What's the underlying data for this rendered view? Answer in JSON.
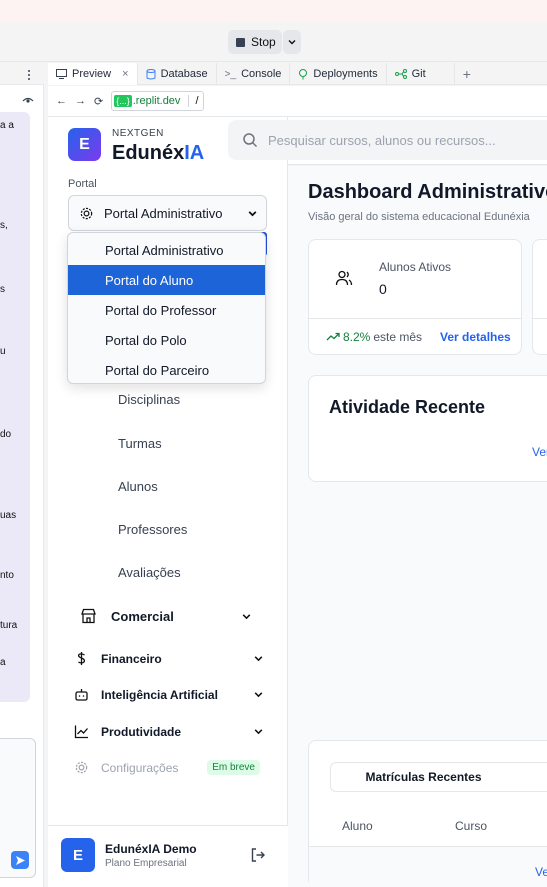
{
  "topbar": {
    "stop_label": "Stop"
  },
  "left_panel": {
    "fragments": [
      "a a",
      "s,",
      "s",
      "u",
      "do",
      "uas",
      "nto",
      "tura",
      "a"
    ]
  },
  "tabs": [
    {
      "label": "Preview",
      "icon": "monitor-icon",
      "active": true
    },
    {
      "label": "Database",
      "icon": "database-icon"
    },
    {
      "label": "Console",
      "icon": "terminal-icon"
    },
    {
      "label": "Deployments",
      "icon": "deployments-icon"
    },
    {
      "label": "Git",
      "icon": "git-icon"
    }
  ],
  "urlbar": {
    "domain_badge": "{...}",
    "domain": ".replit.dev",
    "path": "/"
  },
  "app": {
    "brand_small": "NEXTGEN",
    "brand_main": "Edunéx",
    "brand_accent": "IA",
    "logo_letter": "E"
  },
  "search": {
    "placeholder": "Pesquisar cursos, alunos ou recursos..."
  },
  "portal": {
    "label": "Portal",
    "selected": "Portal Administrativo",
    "options": [
      "Portal Administrativo",
      "Portal do Aluno",
      "Portal do Professor",
      "Portal do Polo",
      "Portal do Parceiro"
    ],
    "highlighted_index": 1
  },
  "nav": {
    "subitems": [
      "Disciplinas",
      "Turmas",
      "Alunos",
      "Professores",
      "Avaliações"
    ],
    "groups": [
      {
        "label": "Comercial",
        "icon": "store-icon"
      },
      {
        "label": "Financeiro",
        "icon": "dollar-icon"
      },
      {
        "label": "Inteligência Artificial",
        "icon": "bot-icon"
      },
      {
        "label": "Produtividade",
        "icon": "chart-line-icon"
      }
    ],
    "settings": {
      "label": "Configurações",
      "badge": "Em breve",
      "icon": "gear-icon"
    }
  },
  "user": {
    "avatar": "E",
    "name": "EdunéxIA Demo",
    "plan": "Plano Empresarial"
  },
  "dashboard": {
    "title": "Dashboard Administrativo",
    "subtitle": "Visão geral do sistema educacional Edunéxia",
    "stat": {
      "title": "Alunos Ativos",
      "value": "0",
      "trend_pct": "8.2%",
      "trend_text": "este mês",
      "link": "Ver detalhes"
    },
    "activity": {
      "title": "Atividade Recente",
      "link": "Ver"
    },
    "enrollments": {
      "tab": "Matrículas Recentes",
      "columns": [
        "Aluno",
        "Curso"
      ],
      "link": "Ver"
    }
  },
  "colors": {
    "accent": "#2563eb",
    "highlight": "#1d64d8",
    "success": "#15803d"
  }
}
